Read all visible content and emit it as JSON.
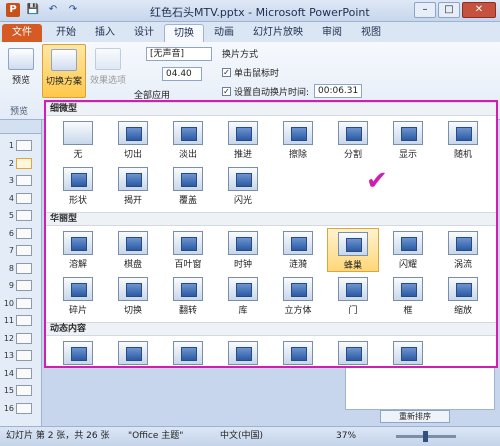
{
  "window": {
    "title": "红色石头MTV.pptx - Microsoft PowerPoint",
    "minimize": "–",
    "maximize": "□",
    "close": "✕"
  },
  "qat": {
    "logo": "P",
    "save": "💾",
    "undo": "↶",
    "redo": "↷"
  },
  "tabs": [
    "文件",
    "开始",
    "插入",
    "设计",
    "切换",
    "动画",
    "幻灯片放映",
    "审阅",
    "视图"
  ],
  "active_tab": "切换",
  "ribbon": {
    "preview_label": "预览",
    "preview_group": "预览",
    "scheme_label": "切换方案",
    "effect_label": "效果选项",
    "sound_value": "[无声音]",
    "duration_value": "04.40",
    "apply_all_label": "全部应用",
    "advance_title": "换片方式",
    "on_click_label": "单击鼠标时",
    "on_click_checked": "✓",
    "after_label": "设置自动换片时间:",
    "after_checked": "✓",
    "after_value": "00:06.31"
  },
  "slides": [
    "1",
    "2",
    "3",
    "4",
    "5",
    "6",
    "7",
    "8",
    "9",
    "10",
    "11",
    "12",
    "13",
    "14",
    "15",
    "16"
  ],
  "selected_slide": "2",
  "gallery": {
    "sections": [
      {
        "title": "细微型",
        "items": [
          "无",
          "切出",
          "淡出",
          "推进",
          "擦除",
          "分割",
          "显示",
          "随机",
          "形状",
          "揭开",
          "覆盖",
          "闪光"
        ]
      },
      {
        "title": "华丽型",
        "items": [
          "溶解",
          "棋盘",
          "百叶窗",
          "时钟",
          "涟漪",
          "蜂巢",
          "闪耀",
          "涡流",
          "碎片",
          "切换",
          "翻转",
          "库",
          "立方体",
          "门",
          "框",
          "缩放"
        ]
      },
      {
        "title": "动态内容",
        "items": [
          "平移",
          "摩天轮",
          "传送带",
          "旋转",
          "窗口",
          "轨道",
          "飞过"
        ]
      }
    ],
    "highlighted": "蜂巢",
    "checkmark": "✔"
  },
  "notes_button": "重新排序",
  "statusbar": {
    "slide_info": "幻灯片 第 2 张，共 26 张",
    "theme": "\"Office 主题\"",
    "language": "中文(中国)",
    "zoom": "37%",
    "zoom_level": 0.37
  }
}
